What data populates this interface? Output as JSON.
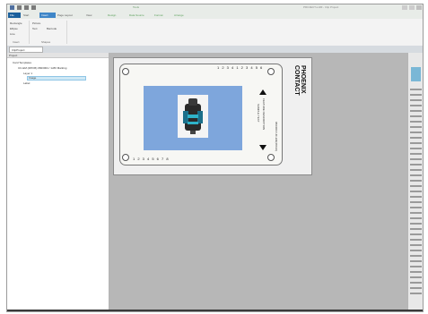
{
  "app": {
    "title": "PROJECT.unifill - Clip Project",
    "context_tab": "Tools"
  },
  "tabs": [
    {
      "label": "File",
      "kind": "file"
    },
    {
      "label": "Start",
      "kind": "normal"
    },
    {
      "label": "Insert",
      "kind": "active"
    },
    {
      "label": "Page Layout",
      "kind": "normal"
    },
    {
      "label": "View",
      "kind": "normal"
    },
    {
      "label": "Design",
      "kind": "ctx"
    },
    {
      "label": "Data Source",
      "kind": "ctx"
    },
    {
      "label": "Format",
      "kind": "ctx"
    },
    {
      "label": "Arrange",
      "kind": "ctx"
    }
  ],
  "ribbon": {
    "items": [
      "Rectangle",
      "Ellipse",
      "Line",
      "Picture",
      "Text",
      "Barcode"
    ],
    "group_labels": [
      "Insert",
      "Shapes"
    ]
  },
  "doc_tab": {
    "label": "ClipProject"
  },
  "left_panel": {
    "header": "Project",
    "tree": [
      {
        "label": "Card Templates",
        "indent": 1
      },
      {
        "label": "UC-EM (48X36) 0823004 / 1x80 Marking",
        "indent": 2
      },
      {
        "label": "Layer 1",
        "indent": 3
      },
      {
        "label": "Image",
        "indent": 3
      },
      {
        "label": "Label",
        "indent": 3
      }
    ]
  },
  "label": {
    "brand_line1": "PHOENIX",
    "brand_line2": "CONTACT",
    "side_text_1": "FEATURE DESCRIPTION",
    "side_text_2": "SAMPLE TEXT",
    "side_text_3": "0823004 UC-EM(48X36)",
    "tick_text": "1 2 3 4 5 6 7 8",
    "top_ticks": "1  2  3  4     1  2  3  4  5  6"
  },
  "colors": {
    "ribbon_file": "#1a5f9c",
    "active_tab": "#3f86c8",
    "label_blue": "#7ea6dc",
    "selection": "#cfe8f5"
  }
}
